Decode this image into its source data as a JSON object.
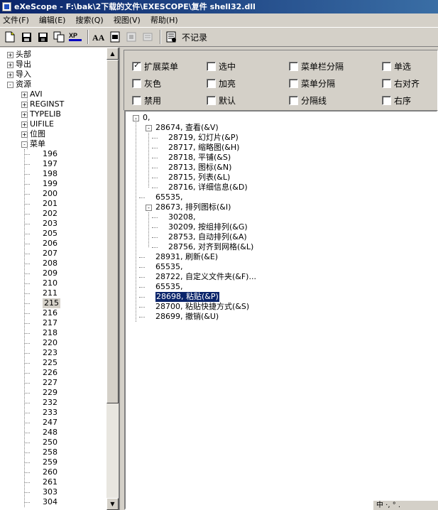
{
  "window": {
    "title": "eXeScope - F:\\bak\\2下载的文件\\EXESCOPE\\复件 shell32.dll"
  },
  "menubar": {
    "items": [
      "文件(F)",
      "编辑(E)",
      "搜索(Q)",
      "视图(V)",
      "帮助(H)"
    ]
  },
  "toolbar": {
    "no_record_label": "不记录",
    "xp_label": "XP",
    "aa_label": "AA"
  },
  "left_tree": {
    "top_items": [
      "头部",
      "导出",
      "导入",
      "资源"
    ],
    "resource_children": [
      "AVI",
      "REGINST",
      "TYPELIB",
      "UIFILE",
      "位图",
      "菜单"
    ],
    "menu_ids": [
      "196",
      "197",
      "198",
      "199",
      "200",
      "201",
      "202",
      "203",
      "205",
      "206",
      "207",
      "208",
      "209",
      "210",
      "211",
      "215",
      "216",
      "217",
      "218",
      "220",
      "223",
      "225",
      "226",
      "227",
      "229",
      "232",
      "233",
      "247",
      "248",
      "250",
      "258",
      "259",
      "260",
      "261",
      "303",
      "304"
    ],
    "selected": "215"
  },
  "options": {
    "col1": [
      {
        "label": "扩展菜单",
        "checked": true
      },
      {
        "label": "灰色",
        "checked": false
      },
      {
        "label": "禁用",
        "checked": false
      }
    ],
    "col2": [
      {
        "label": "选中",
        "checked": false
      },
      {
        "label": "加亮",
        "checked": false
      },
      {
        "label": "默认",
        "checked": false
      }
    ],
    "col3": [
      {
        "label": "菜单栏分隔",
        "checked": false
      },
      {
        "label": "菜单分隔",
        "checked": false
      },
      {
        "label": "分隔线",
        "checked": false
      }
    ],
    "col4": [
      {
        "label": "单选",
        "checked": false
      },
      {
        "label": "右对齐",
        "checked": false
      },
      {
        "label": "右序",
        "checked": false
      }
    ]
  },
  "menu_tree": {
    "root": "0,",
    "g1": {
      "label": "28674, 查看(&V)",
      "children": [
        "28719, 幻灯片(&P)",
        "28717, 缩略图(&H)",
        "28718, 平铺(&S)",
        "28713, 图标(&N)",
        "28715, 列表(&L)",
        "28716, 详细信息(&D)"
      ]
    },
    "sep1": "65535,",
    "g2": {
      "label": "28673, 排列图标(&I)",
      "children": [
        "30208,",
        "30209, 按组排列(&G)",
        "28753, 自动排列(&A)",
        "28756, 对齐到网格(&L)"
      ]
    },
    "r_refresh": "28931, 刷新(&E)",
    "sep2": "65535,",
    "r_custom": "28722, 自定义文件夹(&F)...",
    "sep3": "65535,",
    "r_paste": "28698, 粘贴(&P)",
    "r_paste_shortcut": "28700, 粘贴快捷方式(&S)",
    "r_undo": "28699, 撤销(&U)"
  },
  "bottom": {
    "widget_text": "中 ·, ° ."
  }
}
